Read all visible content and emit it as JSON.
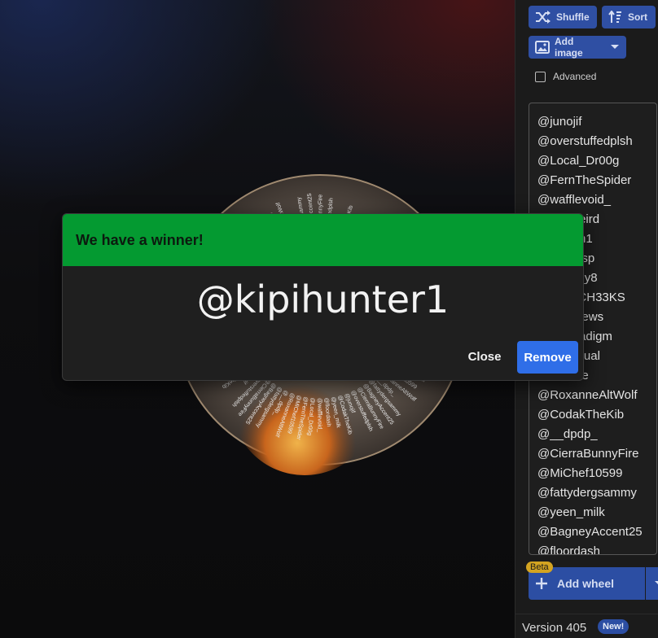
{
  "toolbar": {
    "shuffle_label": "Shuffle",
    "sort_label": "Sort",
    "add_image_label": "Add image",
    "advanced_label": "Advanced",
    "advanced_checked": false
  },
  "entries": [
    "@junojif",
    "@overstuffedplsh",
    "@Local_Dr00g",
    "@FernTheSpider",
    "@wafflevoid_",
    "@...utweird",
    "@...Rem1",
    "@...wkrisp",
    "@...ura_y8",
    "@...OYCH33KS",
    "@...esNews",
    "@...Paradigm",
    "@...sActual",
    "@...erree",
    "@RoxanneAltWolf",
    "@CodakTheKib",
    "@__dpdp_",
    "@CierraBunnyFire",
    "@MiChef10599",
    "@fattydergsammy",
    "@yeen_milk",
    "@BagneyAccent25",
    "@floordash"
  ],
  "wheel": {
    "labels": [
      "@junojif",
      "@CodakTheKib",
      "@yeen_milk",
      "@floordash",
      "@wafflevoid_",
      "@Local_Dr00g",
      "@FernTheSpider",
      "@MiChef10599",
      "@RoxanneAltWolf",
      "@__dpdp_",
      "@fattydergsammy",
      "@BagneyAccent25",
      "@CierraBunnyFire",
      "@overstuffedplsh"
    ]
  },
  "add_wheel": {
    "label": "Add wheel",
    "badge": "Beta"
  },
  "footer": {
    "version": "Version 405",
    "new_badge": "New!"
  },
  "dialog": {
    "title": "We have a winner!",
    "winner": "@kipihunter1",
    "close_label": "Close",
    "remove_label": "Remove"
  },
  "colors": {
    "dialog_header": "#049a31",
    "primary_button": "#2f6ee8",
    "sidebar_button": "#2f4fa3",
    "beta_badge": "#d4a421"
  },
  "icons": {
    "shuffle": "shuffle-icon",
    "sort": "sort-icon",
    "add_image": "image-icon",
    "add_wheel": "plus-icon",
    "dropdown": "chevron-down-icon"
  }
}
